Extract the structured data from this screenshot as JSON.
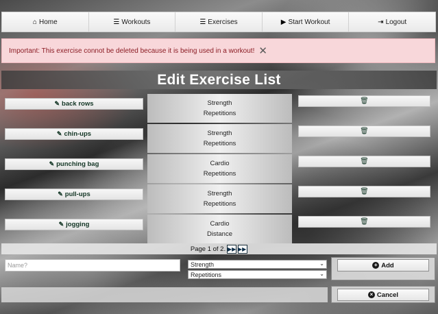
{
  "nav": {
    "items": [
      {
        "label": "Home",
        "icon": "home-icon",
        "glyph": "⌂"
      },
      {
        "label": "Workouts",
        "icon": "list-icon",
        "glyph": "☰"
      },
      {
        "label": "Exercises",
        "icon": "list-icon",
        "glyph": "☰"
      },
      {
        "label": "Start Workout",
        "icon": "play-icon",
        "glyph": "▶"
      },
      {
        "label": "Logout",
        "icon": "sign-out-icon",
        "glyph": "⇥"
      }
    ]
  },
  "alert": {
    "message": "Important: This exercise connot be deleted because it is being used in a workout!",
    "close_glyph": "✕"
  },
  "page": {
    "title": "Edit Exercise List"
  },
  "exercises": [
    {
      "name": "back rows",
      "category": "Strength",
      "measure": "Repetitions"
    },
    {
      "name": "chin-ups",
      "category": "Strength",
      "measure": "Repetitions"
    },
    {
      "name": "punching bag",
      "category": "Cardio",
      "measure": "Repetitions"
    },
    {
      "name": "pull-ups",
      "category": "Strength",
      "measure": "Repetitions"
    },
    {
      "name": "jogging",
      "category": "Cardio",
      "measure": "Distance"
    }
  ],
  "icons": {
    "edit": "✎",
    "trash": "🗑"
  },
  "pager": {
    "text": "Page 1 of 2.",
    "next_glyph": "▶▶",
    "last_glyph": "▶▶|"
  },
  "form": {
    "name_placeholder": "Name?",
    "category_value": "Strength",
    "measure_value": "Repetitions",
    "add_label": "Add",
    "cancel_label": "Cancel"
  }
}
